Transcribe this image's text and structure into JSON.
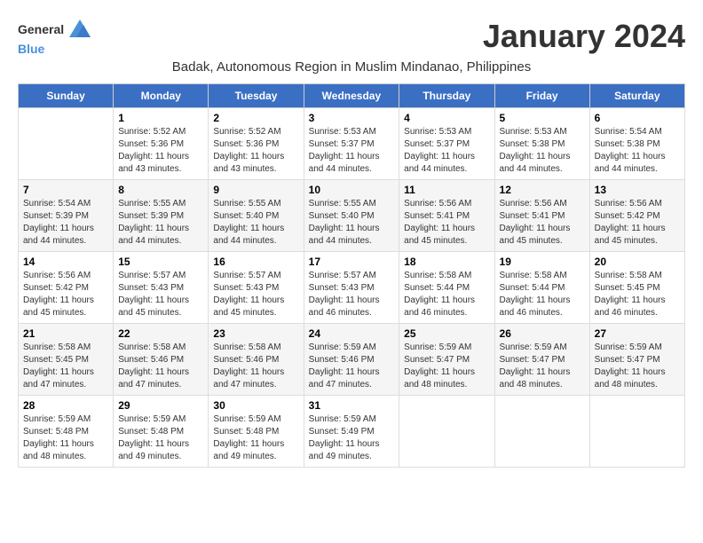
{
  "logo": {
    "general": "General",
    "blue": "Blue"
  },
  "title": "January 2024",
  "subtitle": "Badak, Autonomous Region in Muslim Mindanao, Philippines",
  "days_of_week": [
    "Sunday",
    "Monday",
    "Tuesday",
    "Wednesday",
    "Thursday",
    "Friday",
    "Saturday"
  ],
  "weeks": [
    [
      {
        "day": "",
        "info": ""
      },
      {
        "day": "1",
        "info": "Sunrise: 5:52 AM\nSunset: 5:36 PM\nDaylight: 11 hours\nand 43 minutes."
      },
      {
        "day": "2",
        "info": "Sunrise: 5:52 AM\nSunset: 5:36 PM\nDaylight: 11 hours\nand 43 minutes."
      },
      {
        "day": "3",
        "info": "Sunrise: 5:53 AM\nSunset: 5:37 PM\nDaylight: 11 hours\nand 44 minutes."
      },
      {
        "day": "4",
        "info": "Sunrise: 5:53 AM\nSunset: 5:37 PM\nDaylight: 11 hours\nand 44 minutes."
      },
      {
        "day": "5",
        "info": "Sunrise: 5:53 AM\nSunset: 5:38 PM\nDaylight: 11 hours\nand 44 minutes."
      },
      {
        "day": "6",
        "info": "Sunrise: 5:54 AM\nSunset: 5:38 PM\nDaylight: 11 hours\nand 44 minutes."
      }
    ],
    [
      {
        "day": "7",
        "info": "Sunrise: 5:54 AM\nSunset: 5:39 PM\nDaylight: 11 hours\nand 44 minutes."
      },
      {
        "day": "8",
        "info": "Sunrise: 5:55 AM\nSunset: 5:39 PM\nDaylight: 11 hours\nand 44 minutes."
      },
      {
        "day": "9",
        "info": "Sunrise: 5:55 AM\nSunset: 5:40 PM\nDaylight: 11 hours\nand 44 minutes."
      },
      {
        "day": "10",
        "info": "Sunrise: 5:55 AM\nSunset: 5:40 PM\nDaylight: 11 hours\nand 44 minutes."
      },
      {
        "day": "11",
        "info": "Sunrise: 5:56 AM\nSunset: 5:41 PM\nDaylight: 11 hours\nand 45 minutes."
      },
      {
        "day": "12",
        "info": "Sunrise: 5:56 AM\nSunset: 5:41 PM\nDaylight: 11 hours\nand 45 minutes."
      },
      {
        "day": "13",
        "info": "Sunrise: 5:56 AM\nSunset: 5:42 PM\nDaylight: 11 hours\nand 45 minutes."
      }
    ],
    [
      {
        "day": "14",
        "info": "Sunrise: 5:56 AM\nSunset: 5:42 PM\nDaylight: 11 hours\nand 45 minutes."
      },
      {
        "day": "15",
        "info": "Sunrise: 5:57 AM\nSunset: 5:43 PM\nDaylight: 11 hours\nand 45 minutes."
      },
      {
        "day": "16",
        "info": "Sunrise: 5:57 AM\nSunset: 5:43 PM\nDaylight: 11 hours\nand 45 minutes."
      },
      {
        "day": "17",
        "info": "Sunrise: 5:57 AM\nSunset: 5:43 PM\nDaylight: 11 hours\nand 46 minutes."
      },
      {
        "day": "18",
        "info": "Sunrise: 5:58 AM\nSunset: 5:44 PM\nDaylight: 11 hours\nand 46 minutes."
      },
      {
        "day": "19",
        "info": "Sunrise: 5:58 AM\nSunset: 5:44 PM\nDaylight: 11 hours\nand 46 minutes."
      },
      {
        "day": "20",
        "info": "Sunrise: 5:58 AM\nSunset: 5:45 PM\nDaylight: 11 hours\nand 46 minutes."
      }
    ],
    [
      {
        "day": "21",
        "info": "Sunrise: 5:58 AM\nSunset: 5:45 PM\nDaylight: 11 hours\nand 47 minutes."
      },
      {
        "day": "22",
        "info": "Sunrise: 5:58 AM\nSunset: 5:46 PM\nDaylight: 11 hours\nand 47 minutes."
      },
      {
        "day": "23",
        "info": "Sunrise: 5:58 AM\nSunset: 5:46 PM\nDaylight: 11 hours\nand 47 minutes."
      },
      {
        "day": "24",
        "info": "Sunrise: 5:59 AM\nSunset: 5:46 PM\nDaylight: 11 hours\nand 47 minutes."
      },
      {
        "day": "25",
        "info": "Sunrise: 5:59 AM\nSunset: 5:47 PM\nDaylight: 11 hours\nand 48 minutes."
      },
      {
        "day": "26",
        "info": "Sunrise: 5:59 AM\nSunset: 5:47 PM\nDaylight: 11 hours\nand 48 minutes."
      },
      {
        "day": "27",
        "info": "Sunrise: 5:59 AM\nSunset: 5:47 PM\nDaylight: 11 hours\nand 48 minutes."
      }
    ],
    [
      {
        "day": "28",
        "info": "Sunrise: 5:59 AM\nSunset: 5:48 PM\nDaylight: 11 hours\nand 48 minutes."
      },
      {
        "day": "29",
        "info": "Sunrise: 5:59 AM\nSunset: 5:48 PM\nDaylight: 11 hours\nand 49 minutes."
      },
      {
        "day": "30",
        "info": "Sunrise: 5:59 AM\nSunset: 5:48 PM\nDaylight: 11 hours\nand 49 minutes."
      },
      {
        "day": "31",
        "info": "Sunrise: 5:59 AM\nSunset: 5:49 PM\nDaylight: 11 hours\nand 49 minutes."
      },
      {
        "day": "",
        "info": ""
      },
      {
        "day": "",
        "info": ""
      },
      {
        "day": "",
        "info": ""
      }
    ]
  ]
}
